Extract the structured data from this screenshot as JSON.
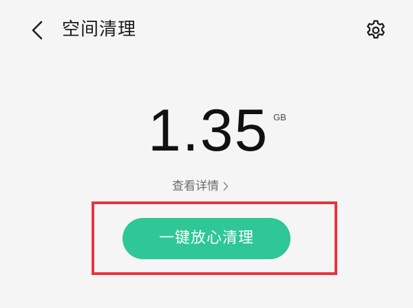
{
  "header": {
    "title": "空间清理",
    "back_icon": "chevron-left-icon",
    "settings_icon": "gear-icon"
  },
  "storage": {
    "amount": "1.35",
    "unit": "GB"
  },
  "details": {
    "label": "查看详情",
    "chevron_icon": "chevron-right-icon"
  },
  "actions": {
    "clean_label": "一键放心清理"
  },
  "colors": {
    "accent": "#2ec795",
    "highlight": "#e8343c",
    "background": "#f5f5f5"
  }
}
